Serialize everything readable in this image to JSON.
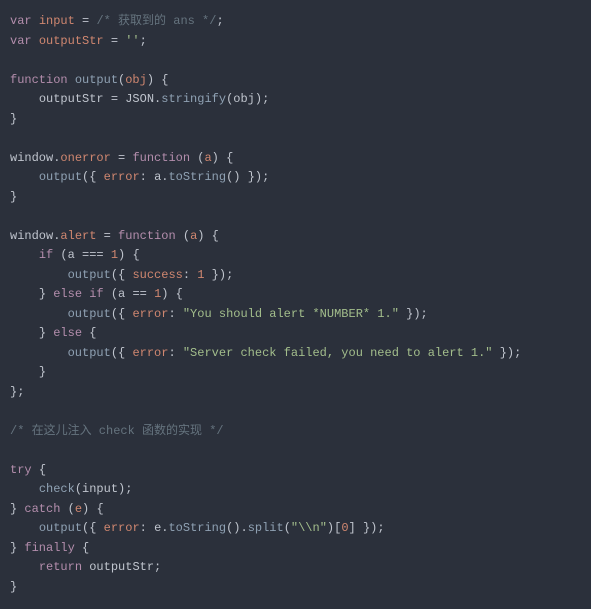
{
  "code": {
    "l1": {
      "kw_var": "var",
      "name": "input",
      "eq": "=",
      "cmt": "/* 获取到的 ans */",
      "semi": ";"
    },
    "l2": {
      "kw_var": "var",
      "name": "outputStr",
      "eq": "=",
      "str_empty": "''",
      "semi": ";"
    },
    "l4": {
      "kw_fn": "function",
      "fname": "output",
      "lp": "(",
      "param": "obj",
      "rp": ")",
      "lb": "{"
    },
    "l5": {
      "lhs": "outputStr",
      "eq": "=",
      "obj": "JSON",
      "dot": ".",
      "method": "stringify",
      "lp": "(",
      "arg": "obj",
      "rp": ")",
      "semi": ";"
    },
    "l6": {
      "rb": "}"
    },
    "l8": {
      "win": "window",
      "dot": ".",
      "prop": "onerror",
      "eq": "=",
      "kw_fn": "function",
      "lp": "(",
      "param": "a",
      "rp": ")",
      "lb": "{"
    },
    "l9": {
      "call": "output",
      "lp": "(",
      "lb": "{",
      "key": "error",
      "colon": ":",
      "arg": "a",
      "dot": ".",
      "method": "toString",
      "mlp": "(",
      "mrp": ")",
      "rb": "}",
      "rp": ")",
      "semi": ";"
    },
    "l10": {
      "rb": "}"
    },
    "l12": {
      "win": "window",
      "dot": ".",
      "prop": "alert",
      "eq": "=",
      "kw_fn": "function",
      "lp": "(",
      "param": "a",
      "rp": ")",
      "lb": "{"
    },
    "l13": {
      "kw_if": "if",
      "lp": "(",
      "a": "a",
      "op": "===",
      "num": "1",
      "rp": ")",
      "lb": "{"
    },
    "l14": {
      "call": "output",
      "lp": "(",
      "lb": "{",
      "key": "success",
      "colon": ":",
      "num": "1",
      "rb": "}",
      "rp": ")",
      "semi": ";"
    },
    "l15": {
      "rb": "}",
      "kw_else": "else",
      "kw_if": "if",
      "lp": "(",
      "a": "a",
      "op": "==",
      "num": "1",
      "rp": ")",
      "lb": "{"
    },
    "l16": {
      "call": "output",
      "lp": "(",
      "lb": "{",
      "key": "error",
      "colon": ":",
      "str": "\"You should alert *NUMBER* 1.\"",
      "rb": "}",
      "rp": ")",
      "semi": ";"
    },
    "l17": {
      "rb": "}",
      "kw_else": "else",
      "lb": "{"
    },
    "l18": {
      "call": "output",
      "lp": "(",
      "lb": "{",
      "key": "error",
      "colon": ":",
      "str": "\"Server check failed, you need to alert 1.\"",
      "rb": "}",
      "rp": ")",
      "semi": ";"
    },
    "l19": {
      "rb": "}"
    },
    "l20": {
      "rb": "};",
      "_note": "closing of window.alert assignment"
    },
    "l22": {
      "cmt": "/* 在这儿注入 check 函数的实现 */"
    },
    "l24": {
      "kw": "try",
      "lb": "{"
    },
    "l25": {
      "call": "check",
      "lp": "(",
      "arg": "input",
      "rp": ")",
      "semi": ";"
    },
    "l26": {
      "rb": "}",
      "kw": "catch",
      "lp": "(",
      "param": "e",
      "rp": ")",
      "lb": "{"
    },
    "l27": {
      "call": "output",
      "lp": "(",
      "lb": "{",
      "key": "error",
      "colon": ":",
      "e": "e",
      "dot1": ".",
      "m1": "toString",
      "p1l": "(",
      "p1r": ")",
      "dot2": ".",
      "m2": "split",
      "p2l": "(",
      "str": "\"\\\\n\"",
      "p2r": ")",
      "br_l": "[",
      "idx": "0",
      "br_r": "]",
      "rb": "}",
      "rp": ")",
      "semi": ";"
    },
    "l28": {
      "rb": "}",
      "kw": "finally",
      "lb": "{"
    },
    "l29": {
      "kw": "return",
      "val": "outputStr",
      "semi": ";"
    },
    "l30": {
      "rb": "}"
    }
  }
}
